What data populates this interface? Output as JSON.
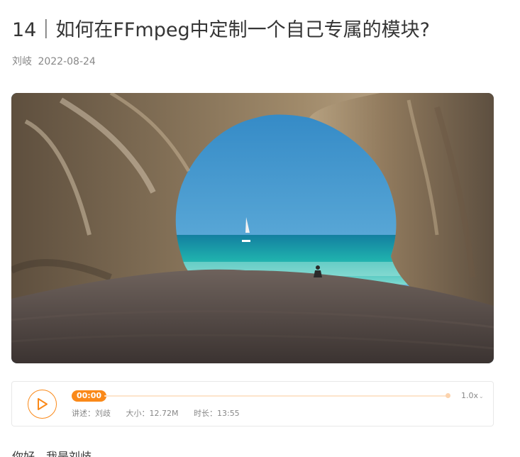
{
  "article": {
    "title": "14｜如何在FFmpeg中定制一个自己专属的模块?",
    "author": "刘岐",
    "date": "2022-08-24",
    "first_line": "你好，我是刘歧。"
  },
  "cover": {
    "icon": "cave-beach-image",
    "colors": {
      "sky": "#3d96cf",
      "sea": "#1fa7a9",
      "rock": "#8a7358",
      "sand": "#4e4440"
    }
  },
  "audio": {
    "current_time": "00:00",
    "speed": "1.0x",
    "narrator_label": "讲述：",
    "narrator": "刘歧",
    "size_label": "大小：",
    "size": "12.72M",
    "duration_label": "时长：",
    "duration": "13:55",
    "progress": 0,
    "accent_color": "#fa8919"
  }
}
